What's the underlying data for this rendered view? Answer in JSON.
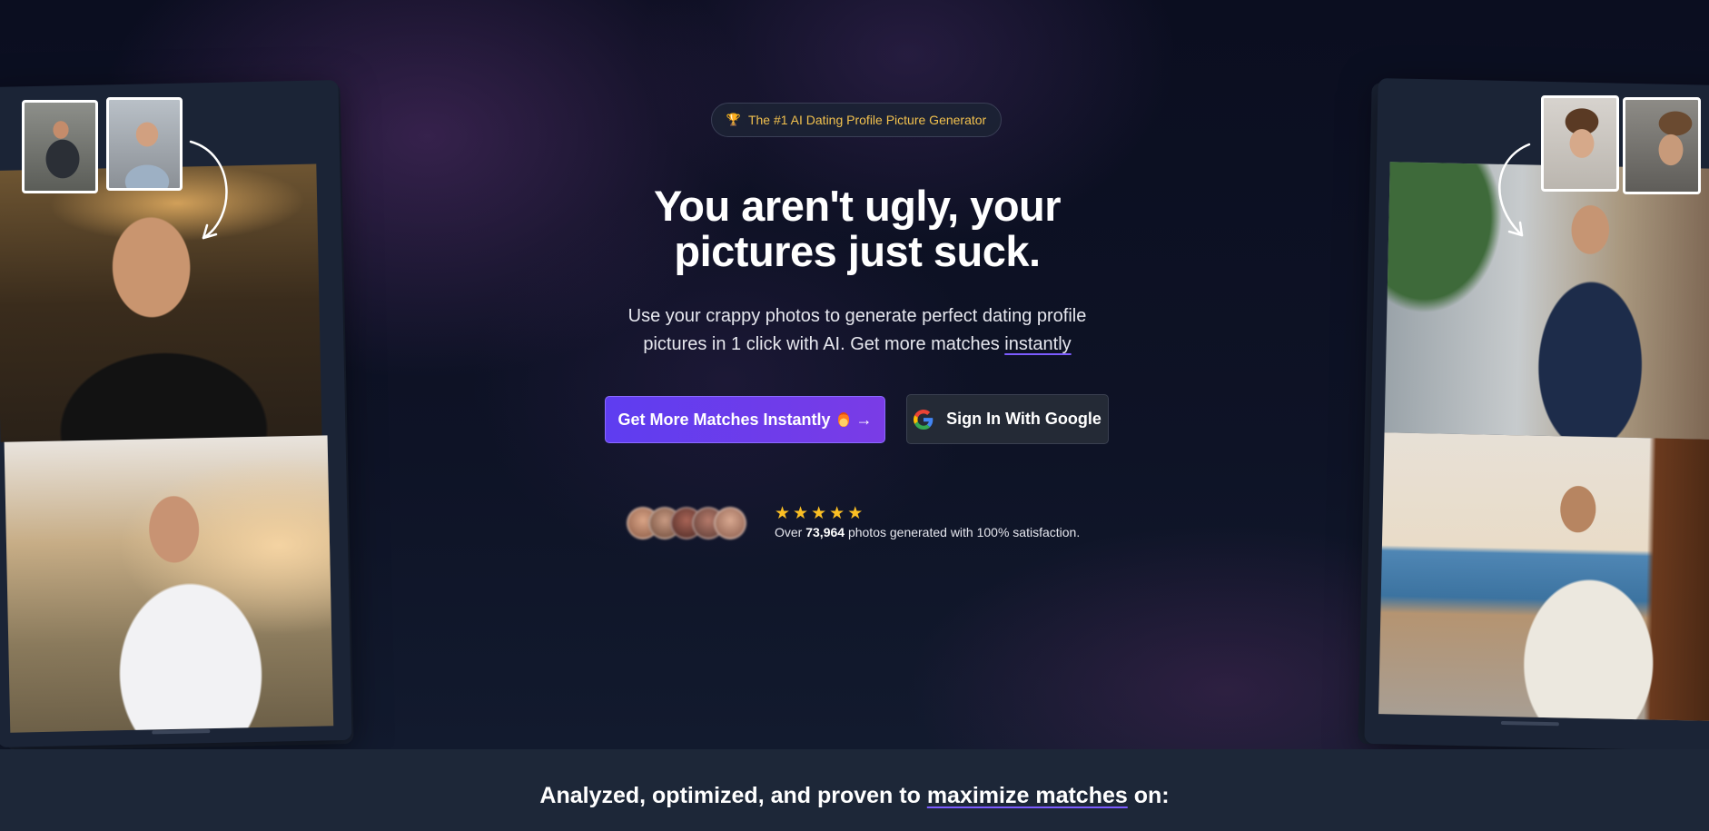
{
  "badge": {
    "icon": "trophy-icon",
    "text": "The #1 AI Dating Profile Picture Generator"
  },
  "hero": {
    "headline_line1": "You aren't ugly, your",
    "headline_line2": "pictures just suck.",
    "subtitle_line1": "Use your crappy photos to generate perfect dating profile",
    "subtitle_line2_prefix": "pictures in 1 click with AI. Get more matches ",
    "subtitle_line2_link": "instantly"
  },
  "buttons": {
    "cta_label": "Get More Matches Instantly",
    "cta_arrow": "→",
    "google_label": "Sign In With Google"
  },
  "social_proof": {
    "rating_stars": 5,
    "text_prefix": "Over ",
    "count": "73,964",
    "text_suffix": " photos generated with 100% satisfaction."
  },
  "footer_band": {
    "prefix": "Analyzed, optimized, and proven to ",
    "link": "maximize matches",
    "suffix": " on:"
  },
  "colors": {
    "accent": "#6d3ff0",
    "badge_text": "#f2c14e",
    "star": "#fbbf24"
  }
}
